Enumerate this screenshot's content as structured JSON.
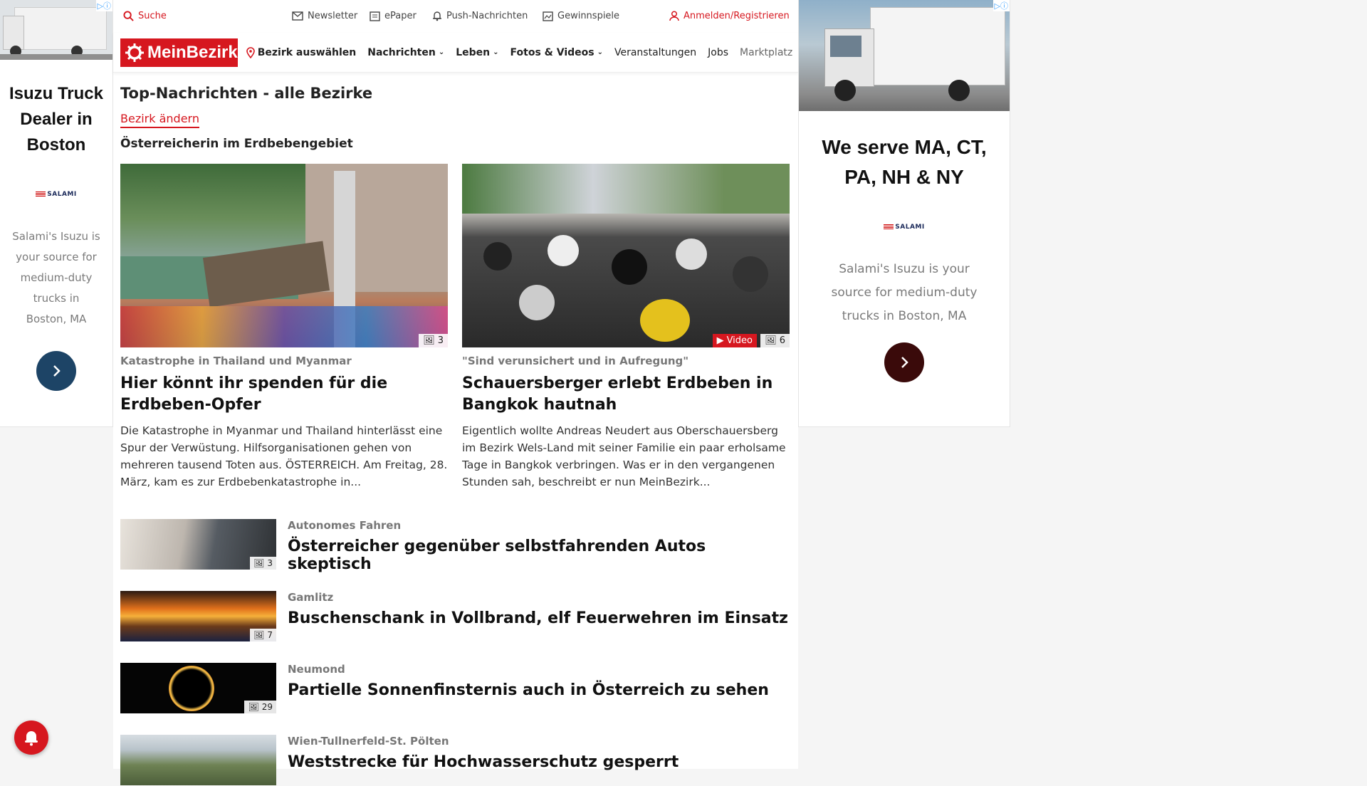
{
  "topbar": {
    "search": "Suche",
    "newsletter": "Newsletter",
    "epaper": "ePaper",
    "push": "Push-Nachrichten",
    "contests": "Gewinnspiele",
    "login": "Anmelden/Registrieren"
  },
  "nav": {
    "logo": "MeinBezirk",
    "district": "Bezirk auswählen",
    "items": [
      "Nachrichten",
      "Leben",
      "Fotos & Videos",
      "Veranstaltungen",
      "Jobs",
      "Marktplatz"
    ]
  },
  "section": {
    "title": "Top-Nachrichten - alle Bezirke",
    "change": "Bezirk ändern",
    "topic": "Österreicherin im Erdbebengebiet"
  },
  "cards": [
    {
      "kicker": "Katastrophe in Thailand und Myanmar",
      "headline": "Hier könnt ihr spenden für die Erdbeben-Opfer",
      "teaser": "Die Katastrophe in Myanmar und Thailand hinterlässt eine Spur der Verwüstung. Hilfsorganisationen gehen von mehreren tausend Toten aus.  ÖSTERREICH. Am Freitag, 28. März, kam es zur Erdbebenkatastrophe in...",
      "images": "3"
    },
    {
      "kicker": "\"Sind verunsichert und in Aufregung\"",
      "headline": "Schauersberger erlebt Erdbeben in Bangkok hautnah",
      "teaser": "Eigentlich wollte Andreas Neudert aus Oberschauersberg im Bezirk Wels-Land mit seiner Familie ein paar erholsame Tage in Bangkok verbringen. Was er in den vergangenen Stunden sah, beschreibt er nun MeinBezirk...",
      "video": "Video",
      "images": "6"
    }
  ],
  "list": [
    {
      "kicker": "Autonomes Fahren",
      "title": "Österreicher gegenüber selbstfahrenden Autos skeptisch",
      "images": "3"
    },
    {
      "kicker": "Gamlitz",
      "title": "Buschenschank in Vollbrand, elf Feuerwehren im Einsatz",
      "images": "7"
    },
    {
      "kicker": "Neumond",
      "title": "Partielle Sonnenfinsternis auch in Österreich zu sehen",
      "images": "29"
    },
    {
      "kicker": "Wien-Tullnerfeld-St. Pölten",
      "title": "Weststrecke für Hochwasserschutz gesperrt",
      "images": ""
    }
  ],
  "ad_left": {
    "title": "Isuzu Truck Dealer in Boston",
    "logo": "SALAMI",
    "text": "Salami's Isuzu is your source for medium-duty trucks in Boston, MA",
    "arrow_color": "#1d4466"
  },
  "ad_right": {
    "title": "We serve MA, CT, PA, NH & NY",
    "logo": "SALAMI",
    "text": "Salami's Isuzu is your source for medium-duty trucks in Boston, MA",
    "arrow_color": "#3a0a0a"
  },
  "colors": {
    "accent": "#d6171f"
  }
}
